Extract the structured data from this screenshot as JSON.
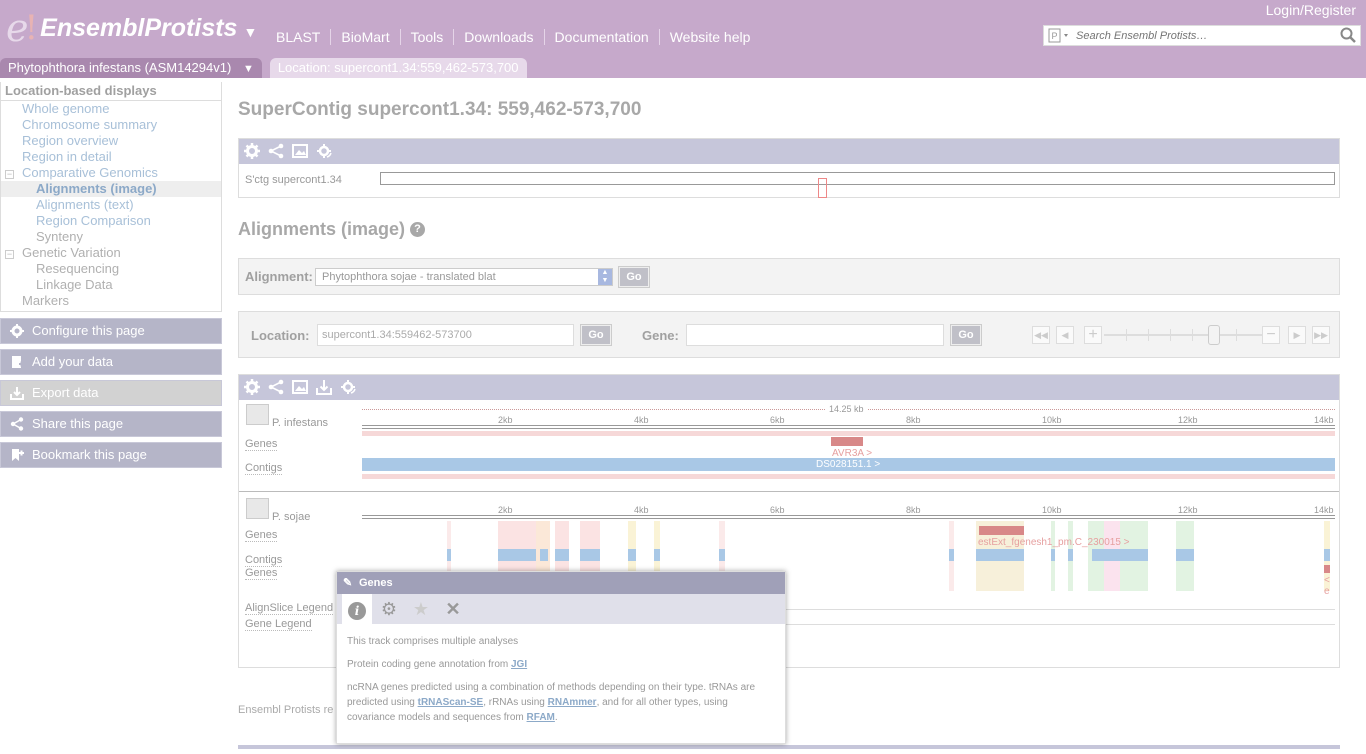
{
  "header": {
    "logo_e": "e",
    "logo_bang": "!",
    "brand": "EnsemblProtists",
    "brand_caret": "▼",
    "login": "Login/Register",
    "nav": [
      "BLAST",
      "BioMart",
      "Tools",
      "Downloads",
      "Documentation",
      "Website help"
    ],
    "search_placeholder": "Search Ensembl Protists…",
    "tabs": {
      "species": "Phytophthora infestans (ASM14294v1)",
      "species_caret": "▼",
      "location": "Location: supercont1.34:559,462-573,700"
    }
  },
  "sidebar": {
    "heading": "Location-based displays",
    "items": [
      {
        "label": "Whole genome"
      },
      {
        "label": "Chromosome summary"
      },
      {
        "label": "Region overview"
      },
      {
        "label": "Region in detail"
      },
      {
        "label": "Comparative Genomics"
      },
      {
        "label": "Alignments (image)"
      },
      {
        "label": "Alignments (text)"
      },
      {
        "label": "Region Comparison"
      },
      {
        "label": "Synteny"
      },
      {
        "label": "Genetic Variation"
      },
      {
        "label": "Resequencing"
      },
      {
        "label": "Linkage Data"
      },
      {
        "label": "Markers"
      }
    ],
    "tools": [
      "Configure this page",
      "Add your data",
      "Export data",
      "Share this page",
      "Bookmark this page"
    ]
  },
  "main": {
    "title": "SuperContig supercont1.34: 559,462-573,700",
    "ideogram_label": "S'ctg supercont1.34",
    "section_title": "Alignments (image)",
    "help_icon": "?",
    "alignment_label": "Alignment:",
    "alignment_value": "Phytophthora sojae - translated blat",
    "go": "Go",
    "location_label": "Location:",
    "location_value": "supercont1.34:559462-573700",
    "gene_label": "Gene:",
    "gene_value": ""
  },
  "viewer": {
    "scale_label": "14.25 kb",
    "ruler_ticks": [
      "2kb",
      "4kb",
      "6kb",
      "8kb",
      "10kb",
      "12kb",
      "14kb"
    ],
    "species": [
      {
        "name": "P. infestans",
        "tracks": [
          "Genes",
          "Contigs"
        ],
        "gene_label": "AVR3A >",
        "contig_label": "DS028151.1 >"
      },
      {
        "name": "P. sojae",
        "tracks": [
          "Genes",
          "Contigs",
          "Genes"
        ],
        "gene_label": "estExt_fgenesh1_pm.C_230015 >",
        "edge_label": "< e"
      }
    ],
    "legends": [
      "AlignSlice Legend",
      "Gene Legend"
    ]
  },
  "footer": "Ensembl Protists re",
  "popup": {
    "title": "Genes",
    "pin_icon": "pin-icon",
    "p1": "This track comprises multiple analyses",
    "p2_text": "Protein coding gene annotation from ",
    "p2_link": "JGI",
    "p3_a": "ncRNA genes predicted using a combination of methods depending on their type. tRNAs are predicted using ",
    "p3_link1": "tRNAScan-SE",
    "p3_b": ", rRNAs using ",
    "p3_link2": "RNAmmer",
    "p3_c": ", and for all other types, using covariance models and sequences from ",
    "p3_link3": "RFAM",
    "p3_d": "."
  },
  "colors": {
    "masthead": "#c6a9cb",
    "gene": "#d08080",
    "contig": "#a9c8e6",
    "toolbar": "#c6c6da"
  }
}
